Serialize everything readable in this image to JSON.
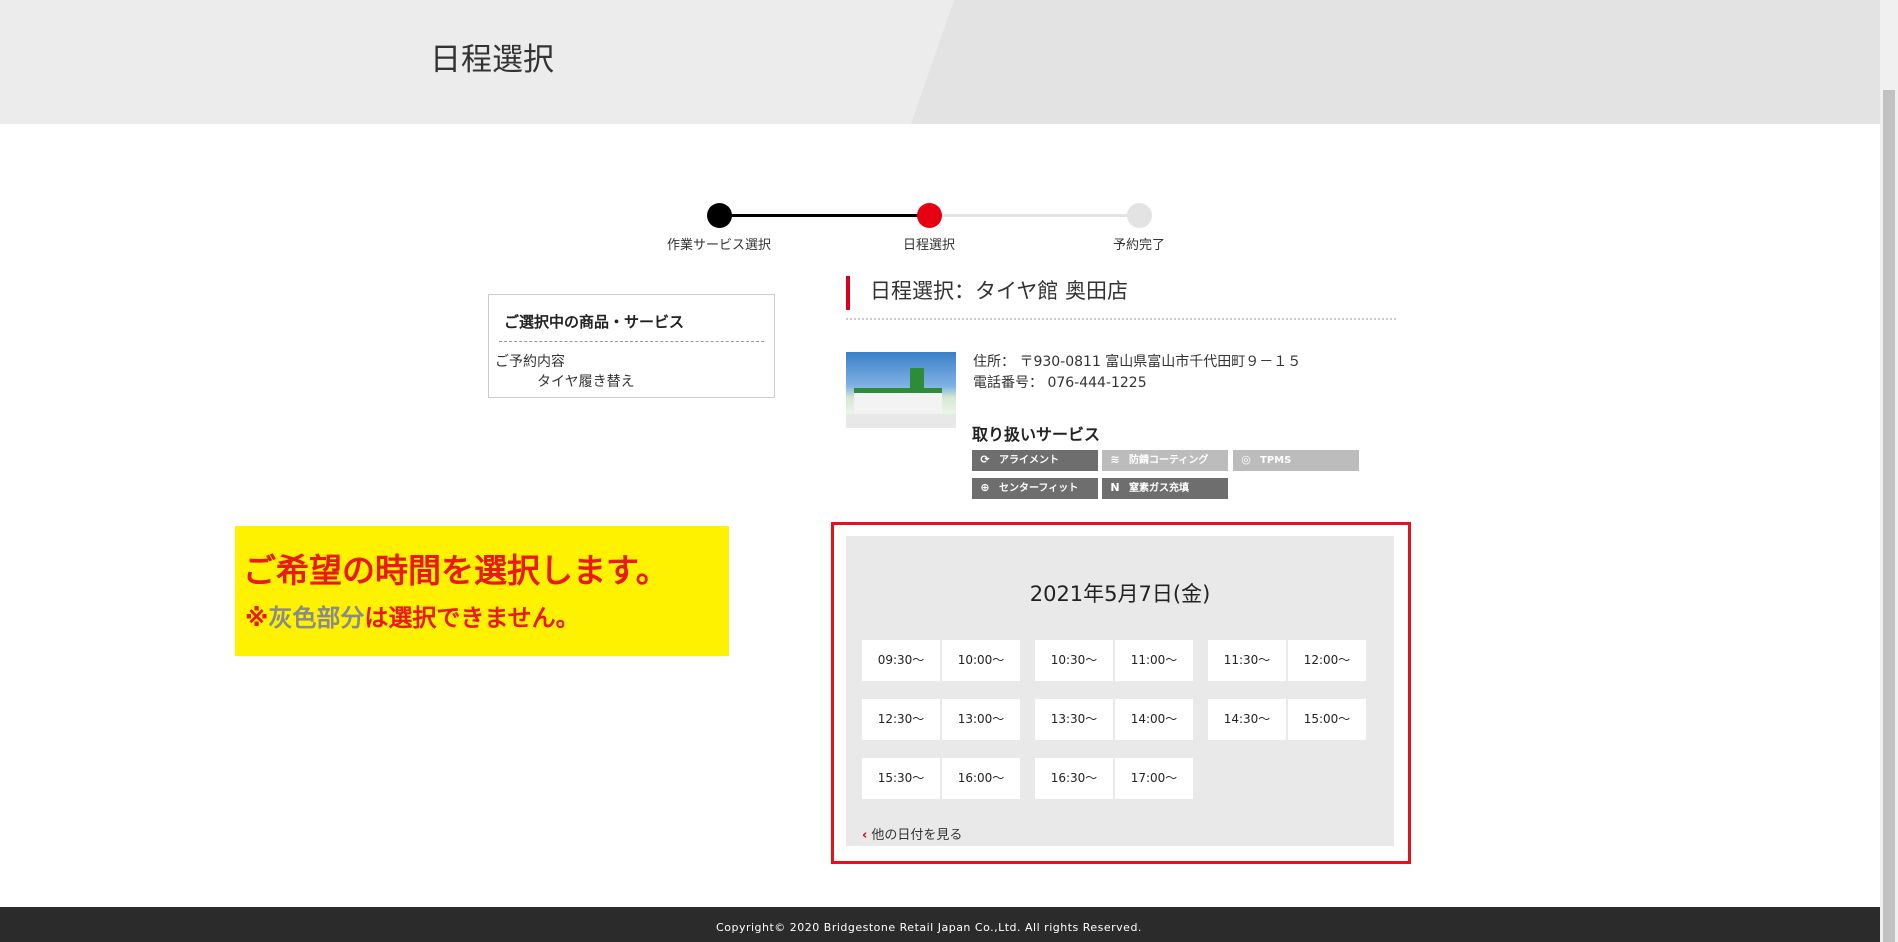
{
  "header": {
    "title": "日程選択"
  },
  "stepper": {
    "steps": [
      {
        "label": "作業サービス選択",
        "state": "done",
        "color": "#000000"
      },
      {
        "label": "日程選択",
        "state": "current",
        "color": "#e60012"
      },
      {
        "label": "予約完了",
        "state": "todo",
        "color": "#e3e3e3"
      }
    ]
  },
  "selection": {
    "title": "ご選択中の商品・サービス",
    "label": "ご予約内容",
    "value": "タイヤ履き替え"
  },
  "shop": {
    "heading": "日程選択：タイヤ館 奥田店",
    "address": "住所： 〒930-0811 富山県富山市千代田町９－１５",
    "phone": "電話番号： 076-444-1225",
    "services_title": "取り扱いサービス",
    "services": [
      {
        "label": "アライメント",
        "icon": "alignment-icon",
        "available": true
      },
      {
        "label": "防錆コーティング",
        "icon": "coating-icon",
        "available": false
      },
      {
        "label": "TPMS",
        "icon": "tpms-icon",
        "available": false
      },
      {
        "label": "センターフィット",
        "icon": "centerfit-icon",
        "available": true
      },
      {
        "label": "窒素ガス充填",
        "icon": "nitrogen-icon",
        "available": true
      }
    ]
  },
  "calendar": {
    "date": "2021年5月7日(金)",
    "slots": [
      "09:30～",
      "10:00～",
      "10:30～",
      "11:00～",
      "11:30～",
      "12:00～",
      "12:30～",
      "13:00～",
      "13:30～",
      "14:00～",
      "14:30～",
      "15:00～",
      "15:30～",
      "16:00～",
      "16:30～",
      "17:00～"
    ],
    "back_link": "他の日付を見る"
  },
  "callout": {
    "main": "ご希望の時間を選択します。",
    "sub_prefix": "※",
    "sub_gray": "灰色部分",
    "sub_suffix": "は選択できません。"
  },
  "footer": {
    "copyright": "Copyright© 2020 Bridgestone Retail Japan Co.,Ltd. All rights Reserved."
  },
  "colors": {
    "accent": "#e2131f",
    "callout_bg": "#fff200",
    "footer_bg": "#2b2b2b"
  }
}
